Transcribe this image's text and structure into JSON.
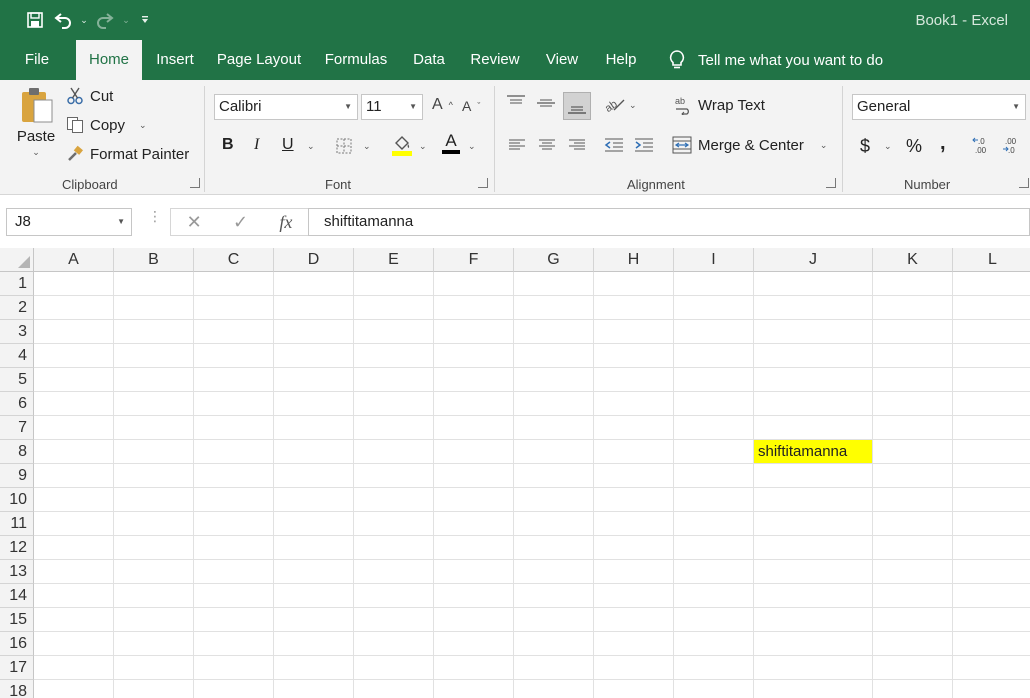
{
  "window": {
    "title": "Book1  -  Excel"
  },
  "tabs": [
    "File",
    "Home",
    "Insert",
    "Page Layout",
    "Formulas",
    "Data",
    "Review",
    "View",
    "Help"
  ],
  "tell_me": "Tell me what you want to do",
  "clipboard": {
    "paste": "Paste",
    "cut": "Cut",
    "copy": "Copy",
    "format_painter": "Format Painter",
    "label": "Clipboard"
  },
  "font": {
    "name": "Calibri",
    "size": "11",
    "bold": "B",
    "italic": "I",
    "underline": "U",
    "font_color": "A",
    "label": "Font"
  },
  "alignment": {
    "wrap_text": "Wrap Text",
    "merge_center": "Merge & Center",
    "label": "Alignment"
  },
  "number": {
    "format": "General",
    "currency": "$",
    "percent": "%",
    "comma": ",",
    "label": "Number"
  },
  "formula_bar": {
    "name_box": "J8",
    "fx": "fx",
    "value": "shiftitamanna"
  },
  "columns": [
    "A",
    "B",
    "C",
    "D",
    "E",
    "F",
    "G",
    "H",
    "I",
    "J",
    "K",
    "L"
  ],
  "rows": [
    "1",
    "2",
    "3",
    "4",
    "5",
    "6",
    "7",
    "8",
    "9",
    "10",
    "11",
    "12",
    "13",
    "14",
    "15",
    "16",
    "17",
    "18"
  ],
  "cells": {
    "J8": "shiftitamanna"
  },
  "colors": {
    "brand": "#217346",
    "highlight": "#ffff00"
  }
}
